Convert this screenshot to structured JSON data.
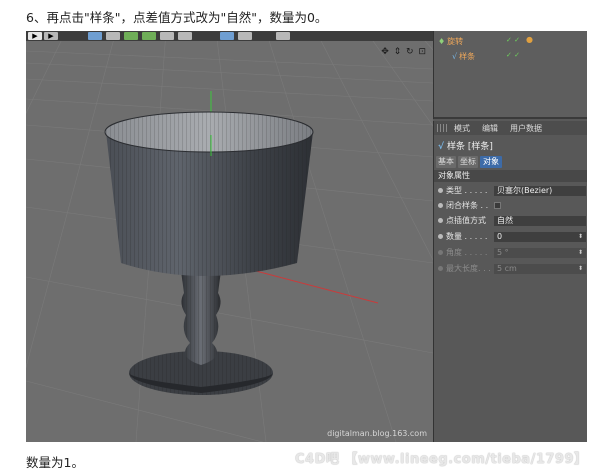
{
  "instruction_text": "6、再点击\"样条\"，点差值方式改为\"自然\"，数量为0。",
  "caption_text": "数量为1。",
  "watermark_text": "C4D吧 【www.lineeg.com/tieba/1799】",
  "viewport": {
    "site_watermark": "digitalman.blog.163.com",
    "nav_icons": "✥ ⇕ ↻ ⊡"
  },
  "object_manager": {
    "items": [
      {
        "icon": "lathe-icon",
        "glyph": "♦",
        "label": "旋转",
        "checks": "✓ ✓"
      },
      {
        "icon": "spline-icon",
        "glyph": "√",
        "label": "样条",
        "checks": "✓ ✓"
      }
    ]
  },
  "attribute_manager": {
    "menu": [
      "模式",
      "编辑",
      "用户数据"
    ],
    "object_title": "样条 [样条]",
    "tabs": [
      "基本",
      "坐标",
      "对象"
    ],
    "active_tab": "对象",
    "section_title": "对象属性",
    "fields": [
      {
        "label": "类型 . . . . .",
        "value": "贝塞尔(Bezier)",
        "kind": "select",
        "enabled": true
      },
      {
        "label": "闭合样条 . .",
        "value": "",
        "kind": "checkbox",
        "enabled": true
      },
      {
        "label": "点插值方式",
        "value": "自然",
        "kind": "select",
        "enabled": true
      },
      {
        "label": "数量 . . . . .",
        "value": "0",
        "kind": "number",
        "enabled": true
      },
      {
        "label": "角度 . . . . .",
        "value": "5 °",
        "kind": "number",
        "enabled": false
      },
      {
        "label": "最大长度. . .",
        "value": "5 cm",
        "kind": "number",
        "enabled": false
      }
    ]
  },
  "colors": {
    "accent_tab": "#3d6ba8",
    "axis_green": "#3cc83c",
    "axis_red": "#c83c3c",
    "object_label": "#f0a85a"
  }
}
